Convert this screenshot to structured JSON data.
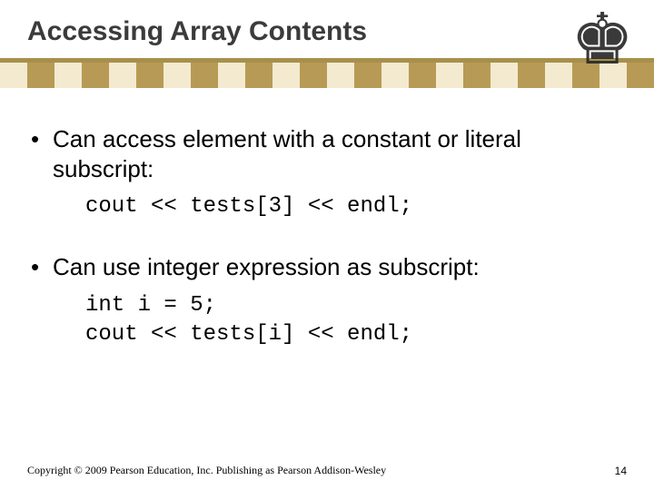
{
  "title": "Accessing Array Contents",
  "decor": {
    "piece_glyph": "♚",
    "bar_color": "#a6904b"
  },
  "bullets": [
    {
      "text": "Can access element with a constant or literal subscript:",
      "code": "cout << tests[3] << endl;"
    },
    {
      "text": "Can use integer expression as subscript:",
      "code": "int i = 5;\ncout << tests[i] << endl;"
    }
  ],
  "footer": {
    "copyright": "Copyright © 2009 Pearson Education, Inc. Publishing as Pearson Addison-Wesley",
    "page": "14"
  }
}
